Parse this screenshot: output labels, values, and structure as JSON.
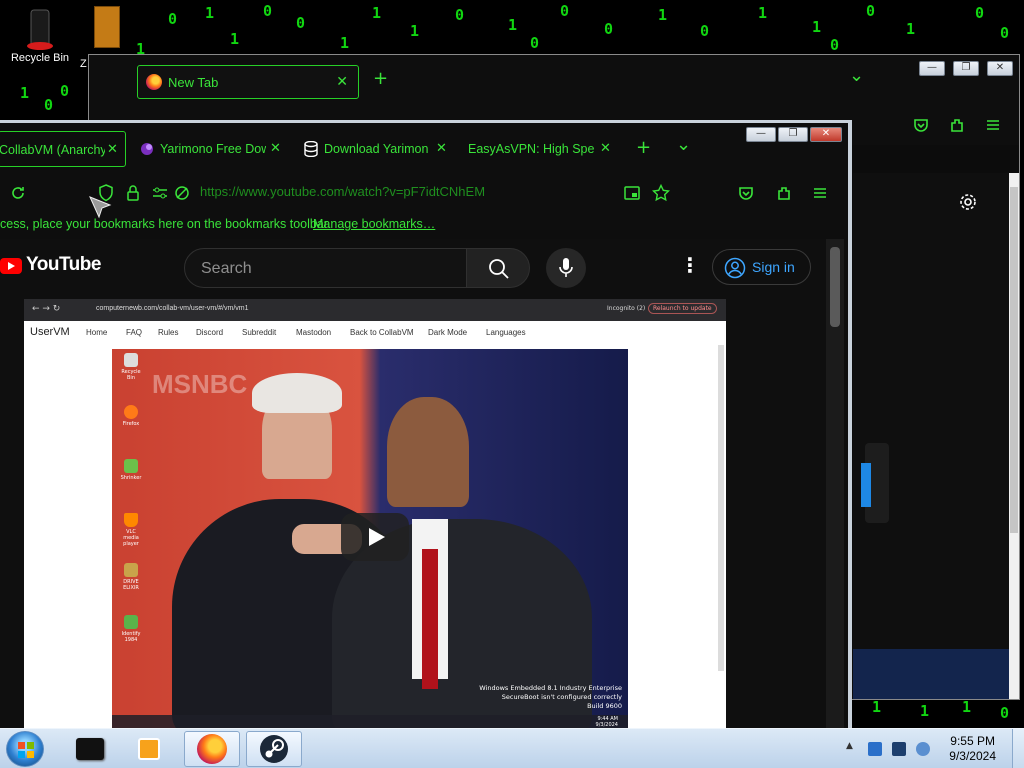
{
  "desktop": {
    "recycle_bin_label": "Recycle Bin",
    "partial_icon_label": "Z",
    "matrix_chars": [
      "1",
      "0",
      "0",
      "1",
      "1",
      "0",
      "1",
      "0",
      "0",
      "1",
      "0",
      "1",
      "1",
      "0",
      "1",
      "0",
      "0",
      "1",
      "1",
      "0",
      "1",
      "0",
      "0",
      "1",
      "1",
      "1",
      "0",
      "1",
      "0",
      "0"
    ]
  },
  "back_window": {
    "tab_title": "New Tab",
    "tab_close": "✕",
    "new_tab": "+",
    "list_tabs": "⌄",
    "minimize": "—",
    "restore": "❐",
    "close": "✕"
  },
  "front_window": {
    "tabs": [
      {
        "label": "CollabVM (Anarchy)",
        "close": "✕"
      },
      {
        "label": "Yarimono Free Downl",
        "close": "✕"
      },
      {
        "label": "Download Yarimono",
        "close": "✕"
      },
      {
        "label": "EasyAsVPN: High Speed",
        "close": "✕"
      }
    ],
    "new_tab": "+",
    "list_tabs": "⌄",
    "url": "https://www.youtube.com/watch?v=pF7idtCNhEM",
    "bookmarks_text": "cess, place your bookmarks here on the bookmarks toolbar.",
    "manage_bookmarks": "Manage bookmarks…"
  },
  "youtube": {
    "wordmark": "YouTube",
    "search_placeholder": "Search",
    "sign_in": "Sign in",
    "kebab": "⋮"
  },
  "video": {
    "url": "computernewb.com/collab-vm/user-vm/#/vm/vm1",
    "incognito": "Incognito (2)",
    "relaunch": "Relaunch to update",
    "nav": [
      "UserVM",
      "Home",
      "FAQ",
      "Rules",
      "Discord",
      "Subreddit",
      "Mastodon",
      "Back to CollabVM",
      "Dark Mode",
      "Languages"
    ],
    "desktop_icons": [
      "Recycle Bin",
      "Firefox",
      "Shrinker",
      "VLC media player",
      "DRIVE ELIXIR",
      "Identify 1984"
    ],
    "sign_text": "MSNBC",
    "watermark": [
      "Windows Embedded 8.1 Industry Enterprise",
      "SecureBoot isn't configured correctly",
      "Build 9600"
    ],
    "vm_time": "9:44 AM",
    "vm_date": "9/3/2024"
  },
  "taskbar": {
    "time": "9:55 PM",
    "date": "9/3/2024",
    "tray_arrow": "▲"
  },
  "colors": {
    "accent_green": "#3ae43a",
    "url_green": "#1f8f1f",
    "youtube_red": "#ff0000",
    "signin_blue": "#3ea6ff"
  }
}
